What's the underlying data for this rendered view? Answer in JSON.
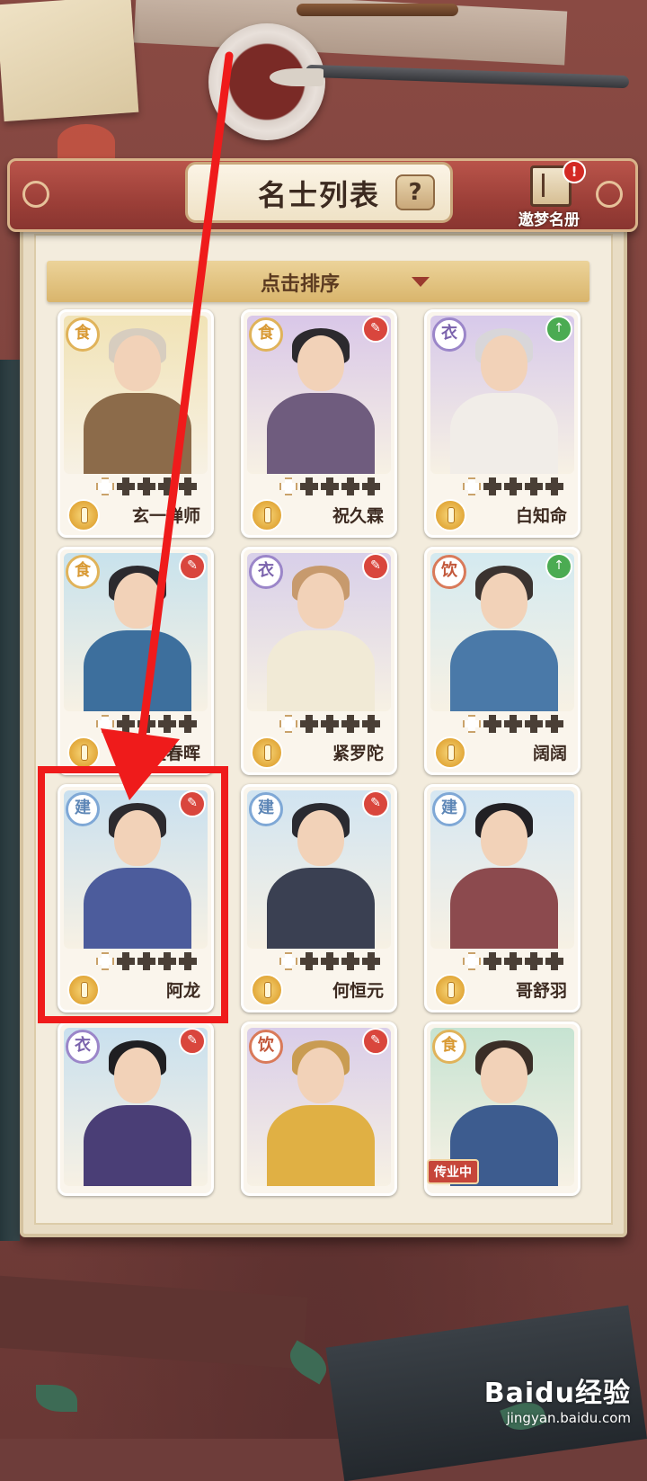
{
  "header": {
    "title": "名士列表",
    "help_label": "?",
    "dream_book_label": "遨梦名册",
    "notification": "!"
  },
  "sort": {
    "label": "点击排序"
  },
  "cards": [
    {
      "name": "玄一禅师",
      "type": "食",
      "type_color": "gold",
      "corner": "none",
      "stars": 4,
      "bg": "#f1e3b6",
      "robe": "#8c6b4a",
      "hair": "#d7cdbf"
    },
    {
      "name": "祝久霖",
      "type": "食",
      "type_color": "gold",
      "corner": "red",
      "stars": 4,
      "bg": "#d9c7e8",
      "robe": "#6f5c7e",
      "hair": "#2c2a2e"
    },
    {
      "name": "白知命",
      "type": "衣",
      "type_color": "purple",
      "corner": "green",
      "stars": 4,
      "bg": "#d7c9ea",
      "robe": "#f1ede8",
      "hair": "#d8d6d9"
    },
    {
      "name": "孟春晖",
      "type": "食",
      "type_color": "gold",
      "corner": "red",
      "stars": 4,
      "bg": "#c8e2ec",
      "robe": "#3d6f9d",
      "hair": "#2c2a2e"
    },
    {
      "name": "紧罗陀",
      "type": "衣",
      "type_color": "purple",
      "corner": "red",
      "stars": 4,
      "bg": "#d8cfe9",
      "robe": "#f1ead6",
      "hair": "#c79a6d"
    },
    {
      "name": "阔阔",
      "type": "饮",
      "type_color": "red",
      "corner": "green",
      "stars": 4,
      "bg": "#d4eaf0",
      "robe": "#4a79a8",
      "hair": "#3b3330"
    },
    {
      "name": "阿龙",
      "type": "建",
      "type_color": "blue",
      "corner": "red",
      "stars": 4,
      "bg": "#c9e0ef",
      "robe": "#4c5c9c",
      "hair": "#2c2a2e"
    },
    {
      "name": "何恒元",
      "type": "建",
      "type_color": "blue",
      "corner": "red",
      "stars": 4,
      "bg": "#d1e4f1",
      "robe": "#3a4052",
      "hair": "#2a2a30"
    },
    {
      "name": "哥舒羽",
      "type": "建",
      "type_color": "blue",
      "corner": "none",
      "stars": 4,
      "bg": "#d6e7f2",
      "robe": "#8c4a4e",
      "hair": "#222024"
    },
    {
      "name": "",
      "type": "衣",
      "type_color": "purple",
      "corner": "red",
      "stars": 4,
      "bg": "#c9e0ee",
      "robe": "#4a3e76",
      "hair": "#1f1f22"
    },
    {
      "name": "",
      "type": "饮",
      "type_color": "red",
      "corner": "red",
      "stars": 4,
      "bg": "#d9cde9",
      "robe": "#e0b044",
      "hair": "#c99c52"
    },
    {
      "name": "",
      "type": "食",
      "type_color": "gold",
      "corner": "none",
      "stars": 4,
      "bg": "#c6e3d2",
      "robe": "#3d5c8f",
      "hair": "#3a2e27",
      "badge": "传业中"
    }
  ],
  "watermark": {
    "brand": "Baidu经验",
    "url": "jingyan.baidu.com"
  }
}
